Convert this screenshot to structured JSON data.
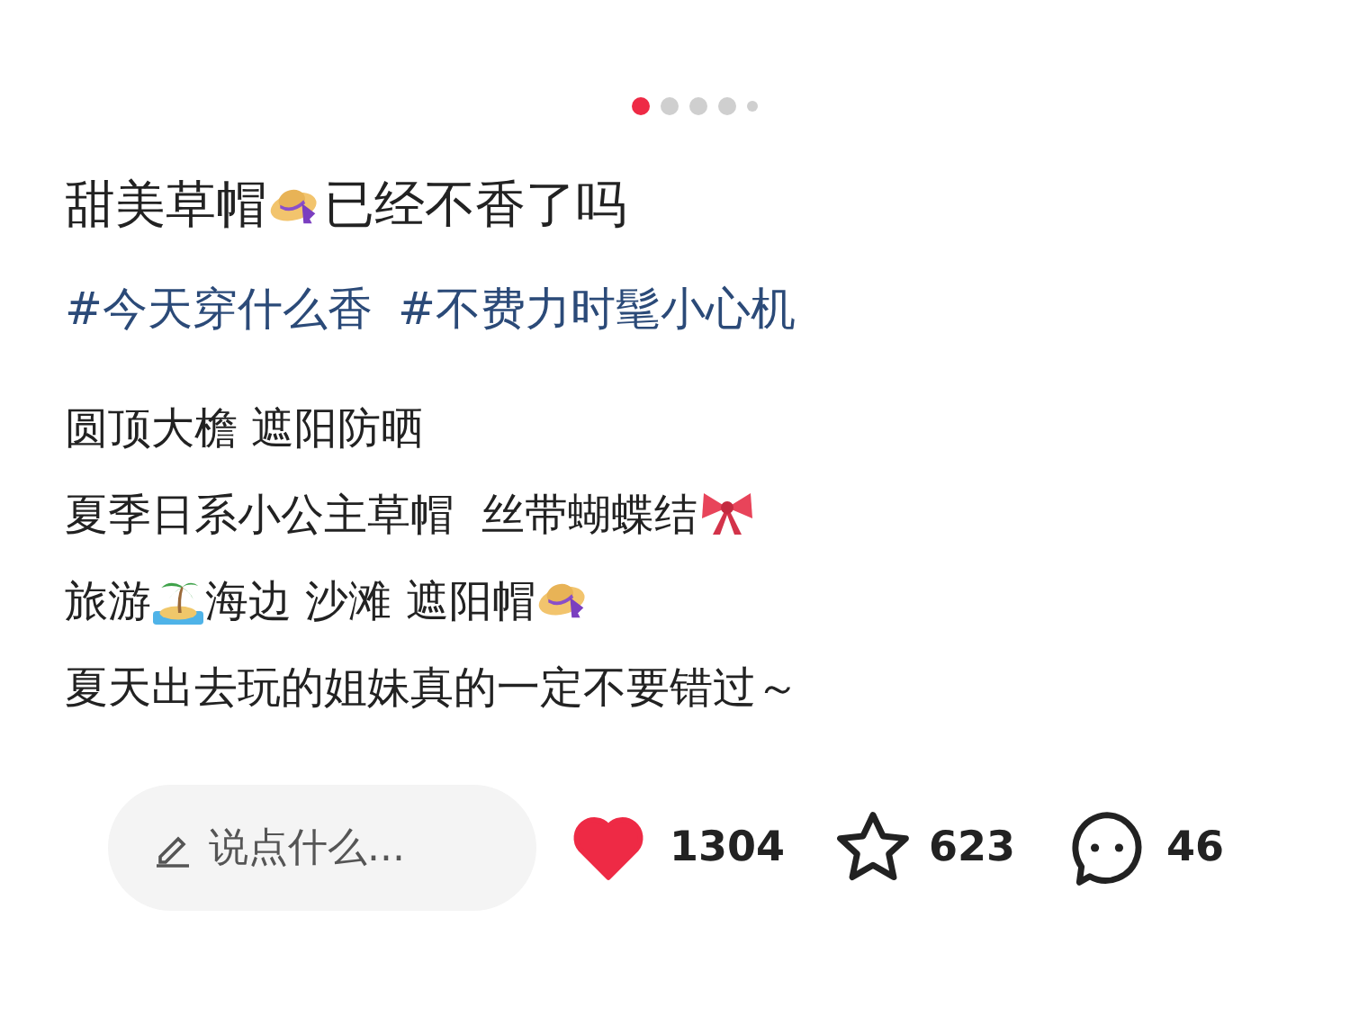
{
  "pager": [
    {
      "selected": true
    },
    {
      "selected": false
    },
    {
      "selected": false
    },
    {
      "selected": false
    },
    {
      "selected": false
    }
  ],
  "title": [
    "甜美草帽",
    "已经不香了吗"
  ],
  "tags": [
    "#今天穿什么香",
    "#不费力时髦小心机"
  ],
  "body": [
    [
      "圆顶大檐 遮阳防晒"
    ],
    [
      "夏季日系小公主草帽  丝带蝴蝶结"
    ],
    [
      "旅游",
      "海边 沙滩 遮阳帽"
    ],
    [
      "夏天出去玩的姐妹真的一定不要错过～"
    ]
  ],
  "comment_field": {
    "placeholder": "说点什么..."
  },
  "likes": {
    "count": "1304",
    "on": true
  },
  "favorites": {
    "count": "623"
  },
  "comments": {
    "count": "46"
  }
}
